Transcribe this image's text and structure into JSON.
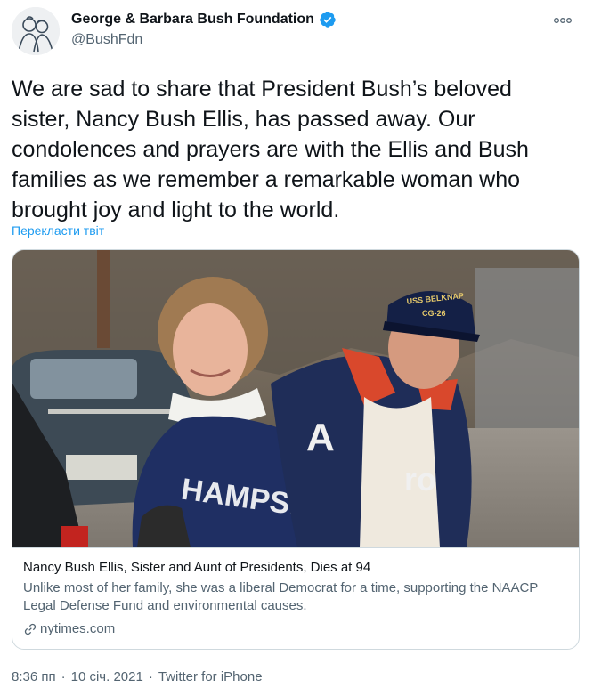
{
  "author": {
    "name": "George & Barbara Bush Foundation",
    "handle": "@BushFdn",
    "verified": true,
    "avatar_icon": "foundation-logo-avatar"
  },
  "more_icon": "ellipsis-icon",
  "tweet": {
    "text": "We are sad to share that President Bush’s beloved sister, Nancy Bush Ellis, has passed away.  Our condolences and prayers are with the Ellis and Bush families as we remember a remarkable woman who brought joy and light to the world.",
    "translate_label": "Перекласти твіт"
  },
  "card": {
    "title": "Nancy Bush Ellis, Sister and Aunt of Presidents, Dies at 94",
    "description": "Unlike most of her family, she was a liberal Democrat for a time, supporting the NAACP Legal Defense Fund and environmental causes.",
    "domain": "nytimes.com",
    "cap_text": "USS BELKNAP",
    "cap_subtext": "CG-26"
  },
  "meta": {
    "time": "8:36 пп",
    "separator": "·",
    "date": "10 січ. 2021",
    "source": "Twitter for iPhone"
  },
  "colors": {
    "accent": "#1d9bf0",
    "text": "#0f1419",
    "muted": "#536471",
    "border": "#cfd9de"
  }
}
